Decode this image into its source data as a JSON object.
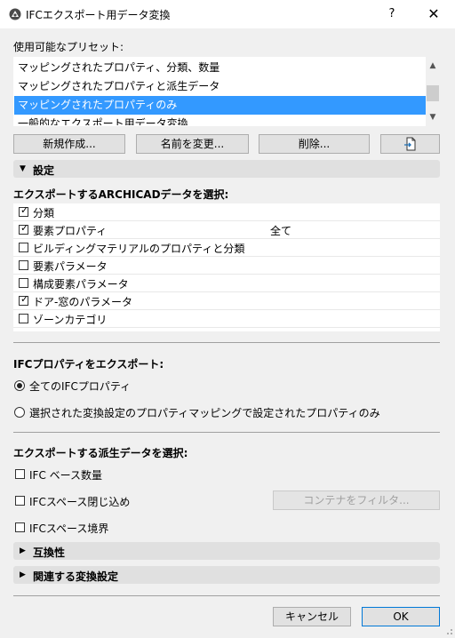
{
  "window": {
    "title": "IFCエクスポート用データ変換",
    "help": "?",
    "close": "✕"
  },
  "presets": {
    "label": "使用可能なプリセット:",
    "items": [
      {
        "label": "マッピングされたプロパティ、分類、数量",
        "selected": false
      },
      {
        "label": "マッピングされたプロパティと派生データ",
        "selected": false
      },
      {
        "label": "マッピングされたプロパティのみ",
        "selected": true
      },
      {
        "label": "一般的なエクスポート用データ変換",
        "selected": false
      }
    ]
  },
  "preset_buttons": {
    "new": "新規作成...",
    "rename": "名前を変更...",
    "delete": "削除...",
    "import_icon": "file-import-icon"
  },
  "settings_section": {
    "title": "設定",
    "expanded": true
  },
  "export_data": {
    "label": "エクスポートするARCHICADデータを選択:",
    "rows": [
      {
        "label": "分類",
        "checked": true,
        "value": ""
      },
      {
        "label": "要素プロパティ",
        "checked": true,
        "value": "全て"
      },
      {
        "label": "ビルディングマテリアルのプロパティと分類",
        "checked": false,
        "value": ""
      },
      {
        "label": "要素パラメータ",
        "checked": false,
        "value": ""
      },
      {
        "label": "構成要素パラメータ",
        "checked": false,
        "value": ""
      },
      {
        "label": "ドア-窓のパラメータ",
        "checked": true,
        "value": ""
      },
      {
        "label": "ゾーンカテゴリ",
        "checked": false,
        "value": ""
      }
    ]
  },
  "ifc_properties": {
    "label": "IFCプロパティをエクスポート:",
    "options": [
      {
        "label": "全てのIFCプロパティ",
        "selected": true
      },
      {
        "label": "選択された変換設定のプロパティマッピングで設定されたプロパティのみ",
        "selected": false
      }
    ]
  },
  "derived_data": {
    "label": "エクスポートする派生データを選択:",
    "options": [
      {
        "label": "IFC ベース数量",
        "checked": false
      },
      {
        "label": "IFCスペース閉じ込め",
        "checked": false
      },
      {
        "label": "IFCスペース境界",
        "checked": false
      }
    ],
    "filter_button": "コンテナをフィルタ..."
  },
  "compat_section": {
    "title": "互換性",
    "expanded": false
  },
  "related_section": {
    "title": "関連する変換設定",
    "expanded": false
  },
  "footer": {
    "cancel": "キャンセル",
    "ok": "OK"
  },
  "colors": {
    "selection": "#3399ff",
    "dialog_bg": "#f0f0f0",
    "ok_border": "#0078d7"
  }
}
